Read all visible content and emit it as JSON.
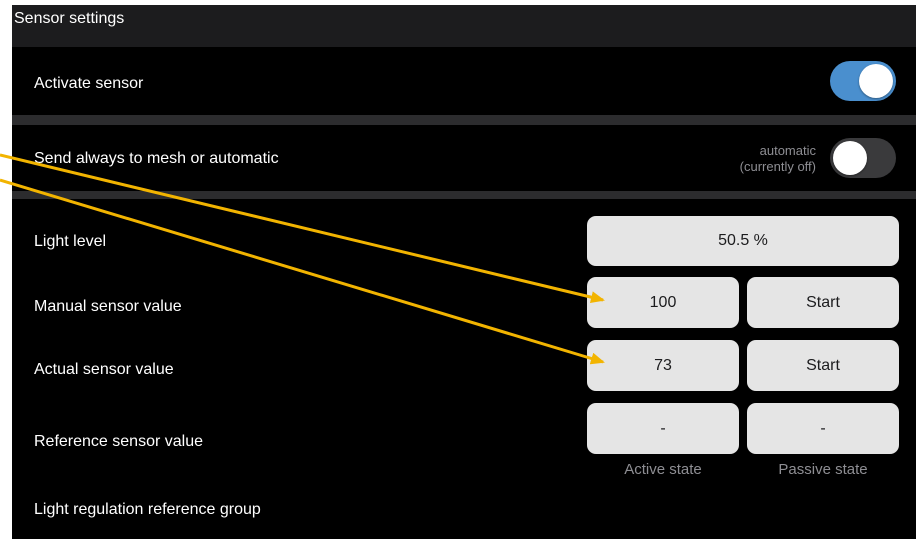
{
  "header": {
    "title": "Sensor settings"
  },
  "activate": {
    "label": "Activate sensor",
    "enabled": true
  },
  "mesh": {
    "label": "Send always to mesh or automatic",
    "status_line1": "automatic",
    "status_line2": "(currently off)",
    "enabled": false
  },
  "light_level": {
    "label": "Light level",
    "value": "50.5 %"
  },
  "manual": {
    "label": "Manual sensor value",
    "value": "100",
    "button": "Start"
  },
  "actual": {
    "label": "Actual sensor value",
    "value": "73",
    "button": "Start"
  },
  "reference": {
    "label": "Reference sensor value",
    "active_value": "-",
    "passive_value": "-",
    "active_caption": "Active state",
    "passive_caption": "Passive state"
  },
  "regulation": {
    "label": "Light regulation reference group"
  },
  "colors": {
    "toggle_on": "#4a8fce",
    "annotation_arrow": "#f2b400"
  }
}
